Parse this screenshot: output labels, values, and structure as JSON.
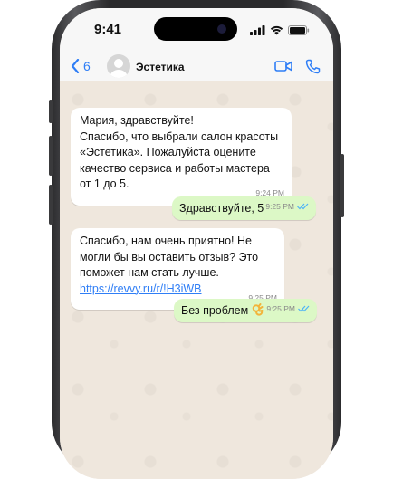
{
  "status_bar": {
    "time": "9:41",
    "icons": [
      "signal-icon",
      "wifi-icon",
      "battery-icon"
    ]
  },
  "chat_header": {
    "back_count": "6",
    "contact_name": "Эстетика",
    "accent_color": "#2f7ef6"
  },
  "messages": [
    {
      "direction": "incoming",
      "text": "Мария, здравствуйте!\nСпасибо, что выбрали салон красоты «Эстетика». Пожалуйста оцените качество сервиса и работы мастера от 1 до 5.",
      "time": "9:24 PM"
    },
    {
      "direction": "outgoing",
      "text": "Здравствуйте, 5",
      "time": "9:25 PM",
      "read_receipt": "double-check-icon"
    },
    {
      "direction": "incoming",
      "text": "Спасибо, нам очень приятно! Не могли бы вы оставить отзыв? Это поможет нам стать лучше. ",
      "link": "https://revvy.ru/r/!H3iWB",
      "time": "9:25 PM"
    },
    {
      "direction": "outgoing",
      "text": "Без проблем",
      "emoji": "ok-hand-emoji",
      "time": "9:25 PM",
      "read_receipt": "double-check-icon"
    }
  ],
  "colors": {
    "incoming_bubble": "#ffffff",
    "outgoing_bubble": "#dcf8c6",
    "wallpaper": "#efe7dd",
    "read_receipt": "#4fb3f6"
  }
}
